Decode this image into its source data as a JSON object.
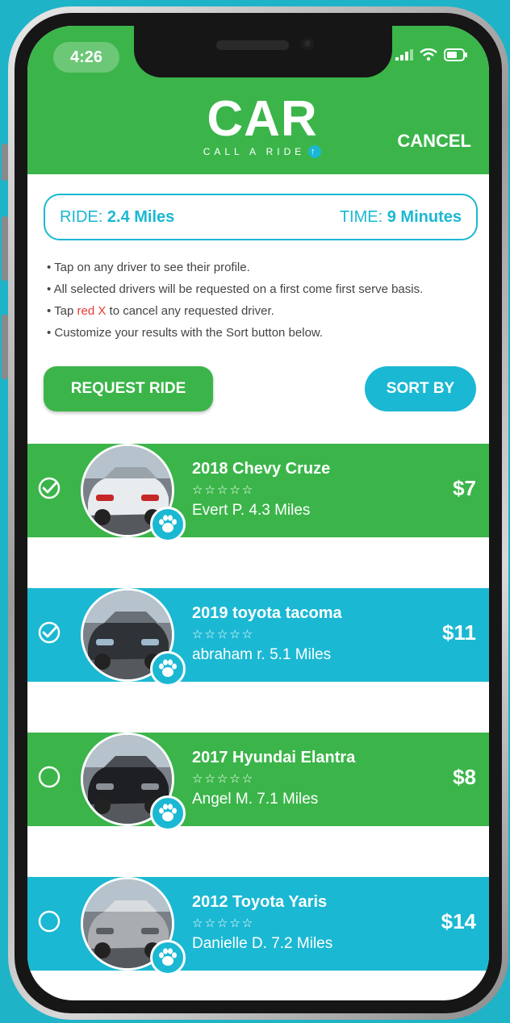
{
  "status": {
    "time": "4:26"
  },
  "header": {
    "logo_main": "CAR",
    "logo_sub": "CALL A RIDE",
    "cancel_label": "CANCEL"
  },
  "summary": {
    "ride_label": "RIDE:",
    "ride_value": "2.4 Miles",
    "time_label": "TIME:",
    "time_value": "9 Minutes"
  },
  "tips": {
    "t1": "• Tap on any driver to see their profile.",
    "t2": "• All selected drivers will be requested on a first come first serve basis.",
    "t3_pre": "• Tap ",
    "t3_red": "red X",
    "t3_post": " to cancel any requested driver.",
    "t4": "• Customize your results with the Sort button below."
  },
  "actions": {
    "request_label": "REQUEST RIDE",
    "sort_label": "SORT BY"
  },
  "drivers": [
    {
      "car": "2018 Chevy Cruze",
      "stars": "☆☆☆☆☆",
      "info": "Evert P.   4.3 Miles",
      "price": "$7",
      "selected": true,
      "color": "#3bb54a"
    },
    {
      "car": "2019 toyota tacoma",
      "stars": "☆☆☆☆☆",
      "info": "abraham r.   5.1 Miles",
      "price": "$11",
      "selected": true,
      "color": "#1bb8d3"
    },
    {
      "car": "2017 Hyundai Elantra",
      "stars": "☆☆☆☆☆",
      "info": "Angel M.   7.1 Miles",
      "price": "$8",
      "selected": false,
      "color": "#3bb54a"
    },
    {
      "car": "2012 Toyota Yaris",
      "stars": "☆☆☆☆☆",
      "info": "Danielle D.   7.2 Miles",
      "price": "$14",
      "selected": false,
      "color": "#1bb8d3"
    }
  ],
  "colors": {
    "green": "#3bb54a",
    "blue": "#1bb8d3",
    "red": "#e53935"
  }
}
